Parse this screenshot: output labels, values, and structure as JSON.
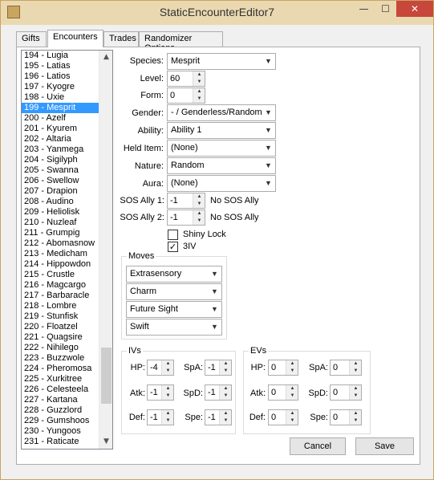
{
  "window": {
    "title": "StaticEncounterEditor7",
    "minimize": "—",
    "maximize": "☐",
    "close": "✕"
  },
  "tabs": [
    {
      "label": "Gifts"
    },
    {
      "label": "Encounters"
    },
    {
      "label": "Trades"
    },
    {
      "label": "Randomizer Options"
    }
  ],
  "pokemon_list": {
    "selected_index": 5,
    "items": [
      "194 - Lugia",
      "195 - Latias",
      "196 - Latios",
      "197 - Kyogre",
      "198 - Uxie",
      "199 - Mesprit",
      "200 - Azelf",
      "201 - Kyurem",
      "202 - Altaria",
      "203 - Yanmega",
      "204 - Sigilyph",
      "205 - Swanna",
      "206 - Swellow",
      "207 - Drapion",
      "208 - Audino",
      "209 - Heliolisk",
      "210 - Nuzleaf",
      "211 - Grumpig",
      "212 - Abomasnow",
      "213 - Medicham",
      "214 - Hippowdon",
      "215 - Crustle",
      "216 - Magcargo",
      "217 - Barbaracle",
      "218 - Lombre",
      "219 - Stunfisk",
      "220 - Floatzel",
      "221 - Quagsire",
      "222 - Nihilego",
      "223 - Buzzwole",
      "224 - Pheromosa",
      "225 - Xurkitree",
      "226 - Celesteela",
      "227 - Kartana",
      "228 - Guzzlord",
      "229 - Gumshoos",
      "230 - Yungoos",
      "231 - Raticate"
    ]
  },
  "form": {
    "species_label": "Species:",
    "species": "Mesprit",
    "level_label": "Level:",
    "level": "60",
    "form_label": "Form:",
    "form": "0",
    "gender_label": "Gender:",
    "gender": "- / Genderless/Random",
    "ability_label": "Ability:",
    "ability": "Ability 1",
    "held_item_label": "Held Item:",
    "held_item": "(None)",
    "nature_label": "Nature:",
    "nature": "Random",
    "aura_label": "Aura:",
    "aura": "(None)",
    "sos1_label": "SOS Ally 1:",
    "sos1": "-1",
    "sos1_desc": "No SOS Ally",
    "sos2_label": "SOS Ally 2:",
    "sos2": "-1",
    "sos2_desc": "No SOS Ally",
    "shiny_lock_label": "Shiny Lock",
    "shiny_lock": false,
    "iv3_label": "3IV",
    "iv3": true
  },
  "moves": {
    "title": "Moves",
    "items": [
      "Extrasensory",
      "Charm",
      "Future Sight",
      "Swift"
    ]
  },
  "ivs": {
    "title": "IVs",
    "hp_label": "HP:",
    "hp": "-4",
    "atk_label": "Atk:",
    "atk": "-1",
    "def_label": "Def:",
    "def": "-1",
    "spa_label": "SpA:",
    "spa": "-1",
    "spd_label": "SpD:",
    "spd": "-1",
    "spe_label": "Spe:",
    "spe": "-1"
  },
  "evs": {
    "title": "EVs",
    "hp_label": "HP:",
    "hp": "0",
    "atk_label": "Atk:",
    "atk": "0",
    "def_label": "Def:",
    "def": "0",
    "spa_label": "SpA:",
    "spa": "0",
    "spd_label": "SpD:",
    "spd": "0",
    "spe_label": "Spe:",
    "spe": "0"
  },
  "buttons": {
    "cancel": "Cancel",
    "save": "Save"
  }
}
